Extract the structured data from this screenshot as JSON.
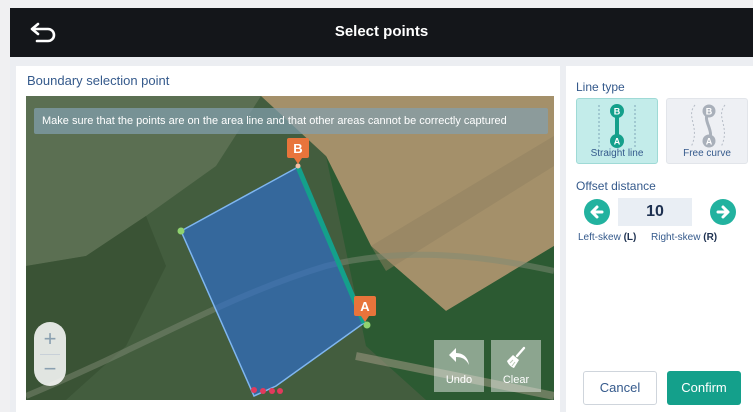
{
  "header": {
    "title": "Select points",
    "back_icon": "back-arrow-icon"
  },
  "left_panel": {
    "title": "Boundary selection point",
    "hint": "Make sure that the points are on the area line and that other areas cannot be correctly captured",
    "markers": {
      "a": "A",
      "b": "B"
    },
    "zoom": {
      "in_label": "+",
      "out_label": "−"
    },
    "tools": {
      "undo_label": "Undo",
      "clear_label": "Clear"
    }
  },
  "right_panel": {
    "line_type_label": "Line type",
    "line_types": [
      {
        "label": "Straight line",
        "selected": true
      },
      {
        "label": "Free curve",
        "selected": false
      }
    ],
    "offset_label": "Offset distance",
    "offset_value": "10",
    "left_skew": {
      "text": "Left-skew",
      "key": "(L)"
    },
    "right_skew": {
      "text": "Right-skew",
      "key": "(R)"
    },
    "cancel_label": "Cancel",
    "confirm_label": "Confirm"
  },
  "colors": {
    "accent": "#14a08b",
    "topbar": "#14161a",
    "marker": "#e8743b",
    "polygon_fill": "#2f6fc4",
    "line_selected": "#14a08b"
  }
}
